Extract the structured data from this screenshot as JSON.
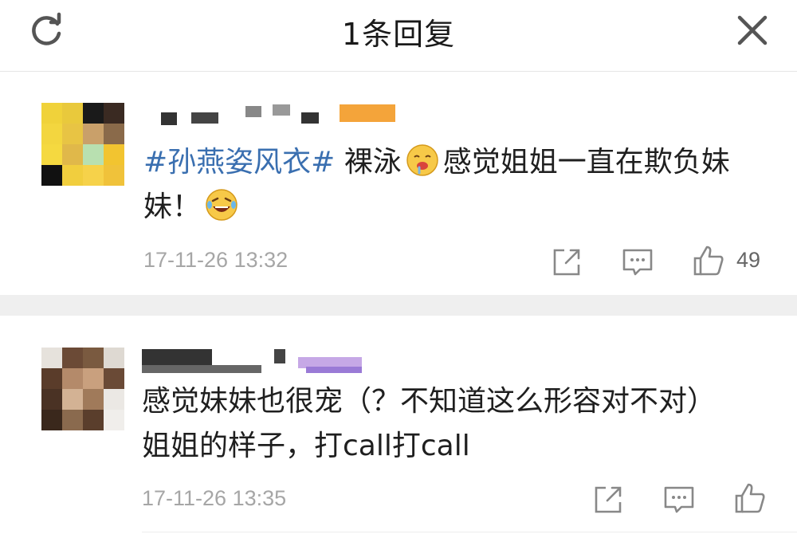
{
  "header": {
    "title": "1条回复",
    "refresh_icon": "refresh-icon",
    "close_icon": "close-icon"
  },
  "comments": [
    {
      "topic": "#孙燕姿风衣#",
      "text_before_emoji": " 裸泳",
      "emoji_1": "drooling-face-emoji",
      "text_after_emoji": "感觉姐姐一直在欺负妹妹！",
      "emoji_2": "laughing-tears-emoji",
      "timestamp": "17-11-26 13:32",
      "like_count": "49"
    },
    {
      "text_line_1": "感觉妹妹也很宠（？不知道这么形容对不对）",
      "text_line_2": "姐姐的样子，打call打call",
      "timestamp": "17-11-26 13:35",
      "like_count": ""
    }
  ],
  "colors": {
    "topic": "#3a6fb0",
    "meta": "#a6a6a6",
    "separator": "#efefef"
  }
}
